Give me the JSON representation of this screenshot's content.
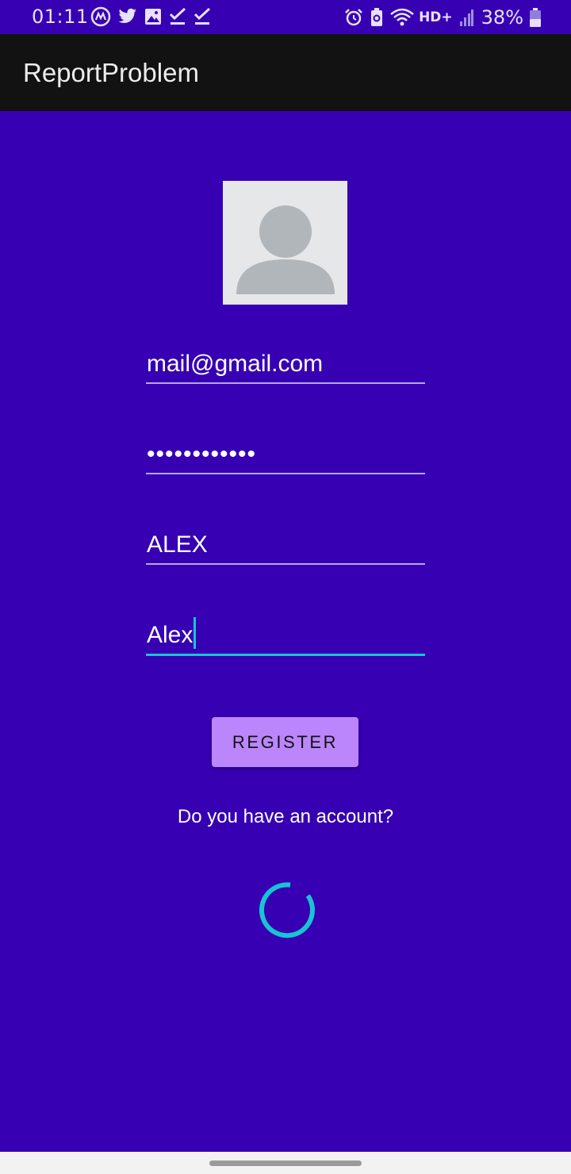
{
  "status_bar": {
    "time": "01:11",
    "network": "HD+",
    "battery": "38%",
    "left_icons": [
      "app-notification-icon",
      "twitter-icon",
      "image-icon",
      "check-icon",
      "check-icon"
    ],
    "right_icons": [
      "alarm-icon",
      "battery-saver-icon",
      "wifi-icon",
      "signal-icon",
      "battery-icon"
    ]
  },
  "app_bar": {
    "title": "ReportProblem"
  },
  "avatar": {
    "icon": "person-placeholder-icon"
  },
  "form": {
    "email": "mail@gmail.com",
    "password": "••••••••••••",
    "name": "ALEX",
    "username": "Alex"
  },
  "actions": {
    "register_label": "REGISTER",
    "account_link": "Do you have an account?"
  },
  "colors": {
    "background": "#3700b3",
    "app_bar": "#121212",
    "button": "#bb86fc",
    "accent": "#19c3d3"
  }
}
